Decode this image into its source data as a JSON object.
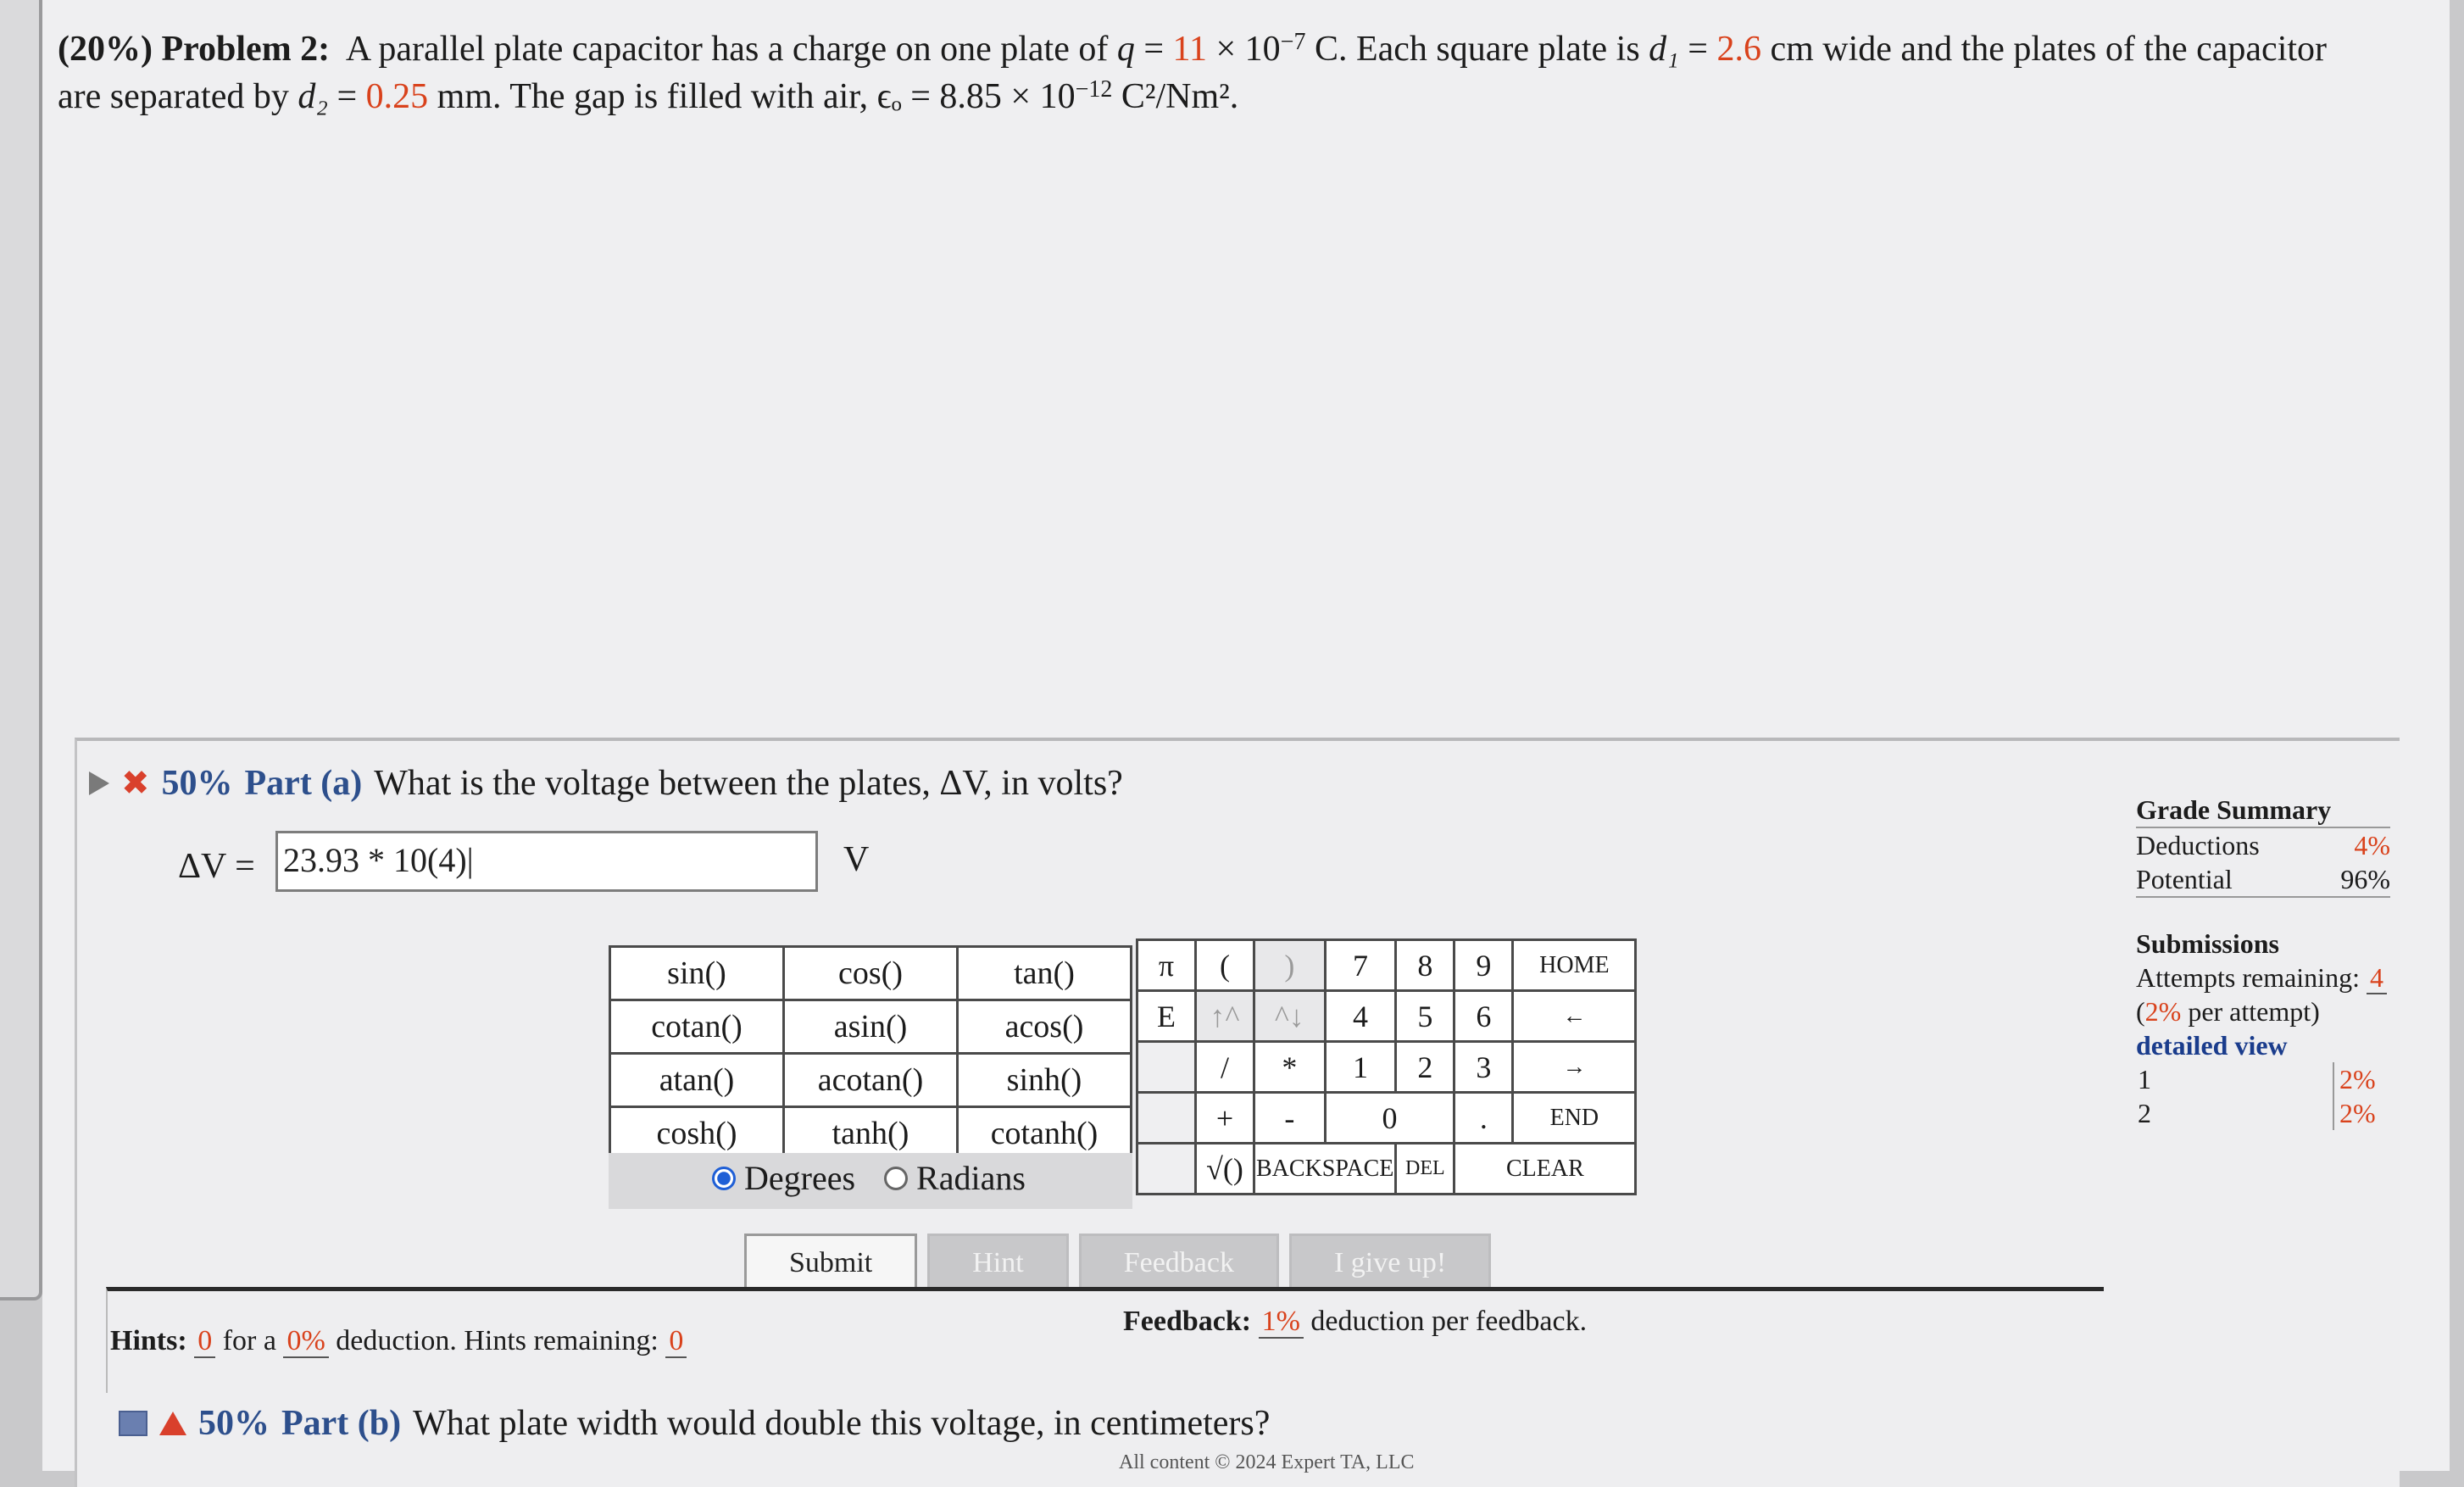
{
  "problem": {
    "weight": "(20%)",
    "title": "Problem 2:",
    "text1": "A parallel plate capacitor has a charge on one plate of",
    "q_sym": "q",
    "q_val": "11",
    "q_rest": "× 10",
    "q_exp": "−7",
    "q_unit": "C. Each square plate is",
    "d1_sym": "d₁",
    "d1_val": "2.6",
    "d1_rest": "cm wide and the plates of the capacitor",
    "text2": "are separated by",
    "d2_sym": "d₂",
    "d2_val": "0.25",
    "d2_rest": "mm. The gap is filled with air,",
    "eps": "ϵₒ = 8.85 × 10",
    "eps_exp": "−12",
    "eps_unit": "C²/Nm²."
  },
  "part_a": {
    "percent": "50%",
    "label": "Part (a)",
    "question": "What is the voltage between the plates, ΔV, in volts?",
    "answer_label": "ΔV =",
    "answer_value": "23.93 * 10(4)|",
    "unit": "V"
  },
  "functions": [
    [
      "sin()",
      "cos()",
      "tan()"
    ],
    [
      "cotan()",
      "asin()",
      "acos()"
    ],
    [
      "atan()",
      "acotan()",
      "sinh()"
    ],
    [
      "cosh()",
      "tanh()",
      "cotanh()"
    ]
  ],
  "mode": {
    "degrees": "Degrees",
    "radians": "Radians"
  },
  "keypad": {
    "pi": "π",
    "lparen": "(",
    "rparen": ")",
    "k7": "7",
    "k8": "8",
    "k9": "9",
    "home": "HOME",
    "e": "E",
    "up": "↑^",
    "down": "^↓",
    "k4": "4",
    "k5": "5",
    "k6": "6",
    "left": "←",
    "div": "/",
    "mul": "*",
    "k1": "1",
    "k2": "2",
    "k3": "3",
    "right": "→",
    "plus": "+",
    "minus": "-",
    "k0": "0",
    "dot": ".",
    "end": "END",
    "sqrt": "√()",
    "backspace": "BACKSPACE",
    "del": "DEL",
    "clear": "CLEAR"
  },
  "buttons": {
    "submit": "Submit",
    "hint": "Hint",
    "feedback": "Feedback",
    "giveup": "I give up!"
  },
  "hints": {
    "label": "Hints:",
    "count": "0",
    "for_a": "for a",
    "pct": "0%",
    "rest": "deduction. Hints remaining:",
    "remaining": "0"
  },
  "feedback": {
    "label": "Feedback:",
    "pct": "1%",
    "rest": "deduction per feedback."
  },
  "part_b": {
    "percent": "50%",
    "label": "Part (b)",
    "question": "What plate width would double this voltage, in centimeters?"
  },
  "copyright": "All content © 2024 Expert TA, LLC",
  "summary": {
    "title": "Grade Summary",
    "deductions_label": "Deductions",
    "deductions": "4%",
    "potential_label": "Potential",
    "potential": "96%",
    "submissions_title": "Submissions",
    "attempts_label": "Attempts remaining:",
    "attempts": "4",
    "per_attempt_pct": "2%",
    "per_attempt_rest": "per attempt)",
    "detailed": "detailed view",
    "rows": [
      {
        "n": "1",
        "v": "2%"
      },
      {
        "n": "2",
        "v": "2%"
      }
    ]
  }
}
